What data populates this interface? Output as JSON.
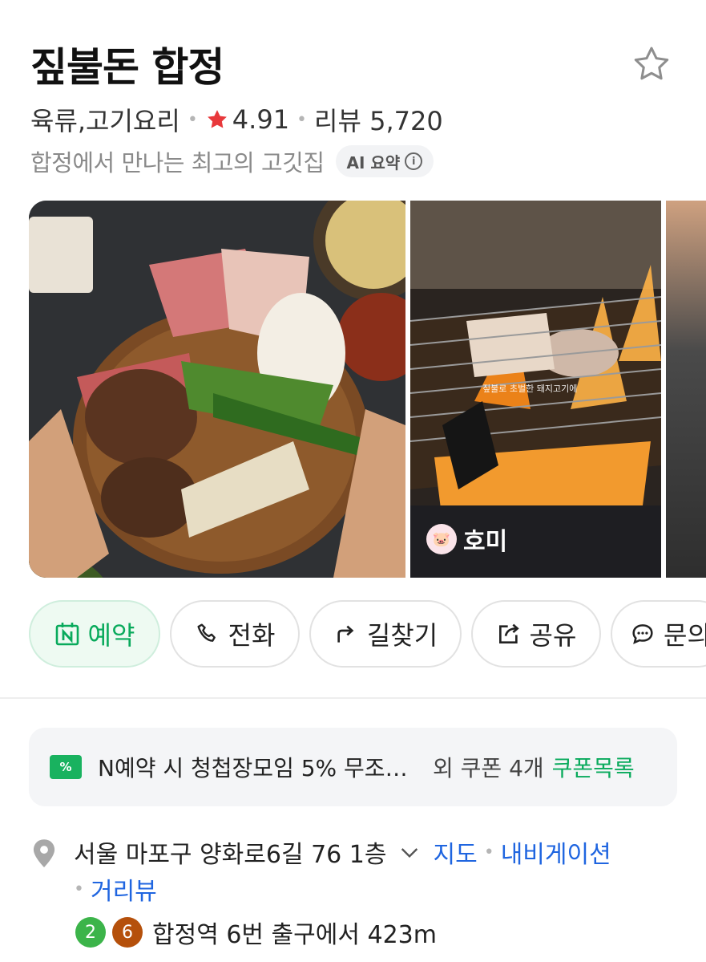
{
  "place": {
    "name": "짚불돈 합정",
    "category": "육류,고기요리",
    "rating": "4.91",
    "review_label": "리뷰 5,720",
    "description": "합정에서 만나는 최고의 고깃집",
    "ai_summary_label": "AI 요약"
  },
  "gallery": {
    "uploader": "호미",
    "caption": "짚불로 초벌한 돼지고기에"
  },
  "actions": [
    {
      "label": "예약",
      "icon": "naver-reservation-icon"
    },
    {
      "label": "전화",
      "icon": "phone-icon"
    },
    {
      "label": "길찾기",
      "icon": "directions-icon"
    },
    {
      "label": "공유",
      "icon": "share-icon"
    },
    {
      "label": "문의",
      "icon": "chat-bubble-icon"
    }
  ],
  "coupon": {
    "text": "N예약 시 청첩장모임 5% 무조…",
    "extra": "외 쿠폰 4개",
    "link": "쿠폰목록"
  },
  "address": {
    "text": "서울 마포구 양화로6길 76 1층",
    "map_link": "지도",
    "navigation_link": "내비게이션",
    "street_view_link": "거리뷰"
  },
  "subway": {
    "lines": [
      {
        "number": "2",
        "color": "#3cb44a"
      },
      {
        "number": "6",
        "color": "#b5500b"
      }
    ],
    "text": "합정역 6번 출구에서 423m"
  },
  "colors": {
    "brand_green": "#09aa5c",
    "link_blue": "#1f65e0",
    "rating_star": "#e8383b"
  }
}
